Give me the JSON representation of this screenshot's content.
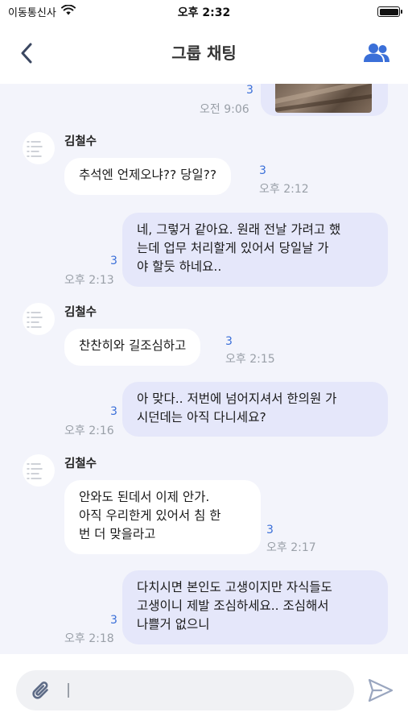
{
  "status_bar": {
    "carrier": "이동통신사",
    "time": "오후 2:32"
  },
  "header": {
    "title": "그룹 채팅"
  },
  "colors": {
    "accent": "#3a6fd8",
    "outgoing_bubble": "#e5e7fa",
    "incoming_bubble": "#ffffff",
    "chat_background": "#f3f4fb"
  },
  "messages": [
    {
      "direction": "out",
      "type": "image",
      "read_count": "3",
      "time": "오전 9:06"
    },
    {
      "direction": "in",
      "sender": "김철수",
      "text": "추석엔 언제오냐?? 당일??",
      "read_count": "3",
      "time": "오후 2:12"
    },
    {
      "direction": "out",
      "text": "네, 그렇거 같아요. 원래 전날 가려고 했는데 업무 처리할게 있어서 당일날 가야 할듯 하네요..",
      "lines": [
        "네, 그렇거 같아요. 원래 전날 가려고 했",
        "는데 업무 처리할게 있어서 당일날 가",
        "야 할듯 하네요.."
      ],
      "read_count": "3",
      "time": "오후 2:13"
    },
    {
      "direction": "in",
      "sender": "김철수",
      "text": "찬찬히와 길조심하고",
      "read_count": "3",
      "time": "오후 2:15"
    },
    {
      "direction": "out",
      "text": "아 맞다.. 저번에 넘어지셔서 한의원 가시던데는 아직 다니세요?",
      "lines": [
        "아 맞다.. 저번에 넘어지셔서 한의원 가",
        "시던데는 아직 다니세요?"
      ],
      "read_count": "3",
      "time": "오후 2:16"
    },
    {
      "direction": "in",
      "sender": "김철수",
      "text": "안와도 된데서 이제 안가. 아직 우리한게 있어서 침 한번 더 맞을라고",
      "lines": [
        "안와도 된데서 이제 안가.",
        "아직 우리한게 있어서 침 한",
        "번 더 맞을라고"
      ],
      "read_count": "3",
      "time": "오후 2:17"
    },
    {
      "direction": "out",
      "text": "다치시면 본인도 고생이지만 자식들도 고생이니 제발 조심하세요.. 조심해서 나쁠거 없으니",
      "lines": [
        "다치시면 본인도 고생이지만 자식들도",
        "고생이니 제발 조심하세요.. 조심해서",
        "나쁠거 없으니"
      ],
      "read_count": "3",
      "time": "오후 2:18"
    }
  ],
  "input": {
    "value": "",
    "placeholder": ""
  },
  "icons": {
    "back": "chevron-left-icon",
    "members": "group-icon",
    "attach": "paperclip-icon",
    "send": "send-icon",
    "wifi": "wifi-icon",
    "battery": "battery-icon"
  }
}
